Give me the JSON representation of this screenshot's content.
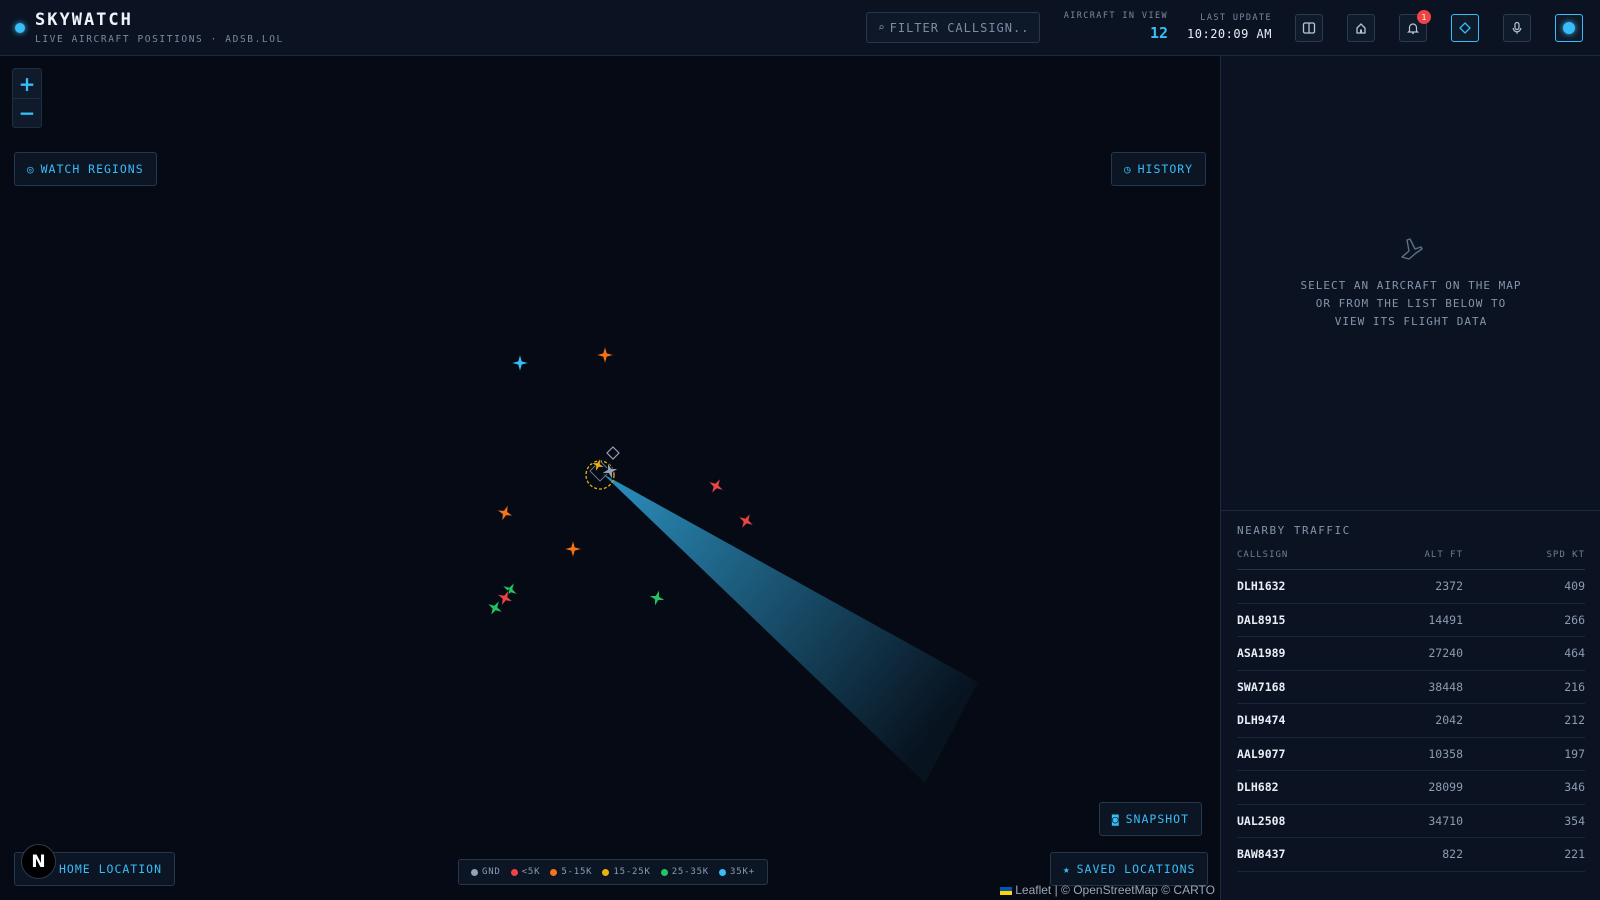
{
  "header": {
    "title": "SKYWATCH",
    "subtitle": "LIVE AIRCRAFT POSITIONS · ADSB.LOL",
    "filter_placeholder": "FILTER CALLSIGN...",
    "aircraft_label": "AIRCRAFT IN VIEW",
    "aircraft_count": "12",
    "update_label": "LAST UPDATE",
    "update_time": "10:20:09 AM",
    "notification_count": "1",
    "accent_color": "#38bdf8"
  },
  "map": {
    "zoom_in": "+",
    "zoom_out": "−",
    "watch_regions": "WATCH REGIONS",
    "history": "HISTORY",
    "snapshot": "SNAPSHOT",
    "home_location": "HOME LOCATION",
    "saved_locations": "SAVED LOCATIONS",
    "compass_letter": "N",
    "attribution": "Leaflet | © OpenStreetMap © CARTO",
    "legend": [
      {
        "label": "GND",
        "color": "#94a3b8"
      },
      {
        "label": "<5K",
        "color": "#ef4444"
      },
      {
        "label": "5-15K",
        "color": "#f97316"
      },
      {
        "label": "15-25K",
        "color": "#eab308"
      },
      {
        "label": "25-35K",
        "color": "#22c55e"
      },
      {
        "label": "35K+",
        "color": "#38bdf8"
      }
    ]
  },
  "detail": {
    "empty_line1": "SELECT AN AIRCRAFT ON THE MAP",
    "empty_line2": "OR FROM THE LIST BELOW TO",
    "empty_line3": "VIEW ITS FLIGHT DATA"
  },
  "traffic": {
    "title": "NEARBY TRAFFIC",
    "columns": [
      "CALLSIGN",
      "ALT FT",
      "SPD KT"
    ],
    "rows": [
      {
        "callsign": "DLH1632",
        "alt": "2372",
        "spd": "409"
      },
      {
        "callsign": "DAL8915",
        "alt": "14491",
        "spd": "266"
      },
      {
        "callsign": "ASA1989",
        "alt": "27240",
        "spd": "464"
      },
      {
        "callsign": "SWA7168",
        "alt": "38448",
        "spd": "216"
      },
      {
        "callsign": "DLH9474",
        "alt": "2042",
        "spd": "212"
      },
      {
        "callsign": "AAL9077",
        "alt": "10358",
        "spd": "197"
      },
      {
        "callsign": "DLH682",
        "alt": "28099",
        "spd": "346"
      },
      {
        "callsign": "UAL2508",
        "alt": "34710",
        "spd": "354"
      },
      {
        "callsign": "BAW8437",
        "alt": "822",
        "spd": "221"
      }
    ]
  }
}
